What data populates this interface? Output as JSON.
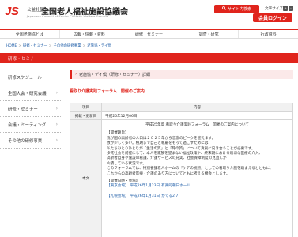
{
  "header": {
    "logo": "JS",
    "org_small": "公益社団法人",
    "org_name": "全国老人福祉施設協議会",
    "org_en": "Japanese Council of Senior Citizens Welfare Service",
    "search_label": "サイト内検索",
    "search_icon": "search-icon",
    "font_size_label": "文字サイズ",
    "font_plus": "+",
    "font_minus": "-",
    "login_label": "会員ログイン"
  },
  "nav": {
    "items": [
      "全国老施協とは",
      "広報・情報・資料",
      "研修・セミナー",
      "調査・研究",
      "行政資料"
    ]
  },
  "breadcrumb": {
    "items": [
      "HOME",
      "研修・セミナー",
      "その他の研修事業",
      "老施協・デイ倶"
    ],
    "sep": ">"
  },
  "banner": {
    "title": "研修・セミナー"
  },
  "sidebar": {
    "items": [
      "研修スケジュール",
      "全国大会・研究会議",
      "研修・セミナー",
      "会議・ミーティング",
      "その他の研修事業"
    ],
    "chev": "›"
  },
  "main": {
    "title_icon": "›",
    "title": "老施協・デイ倶（研修・セミナー）詳細",
    "sub_title": "看取り介護実践フォーラム　開催のご案内",
    "table": {
      "col_item": "項目",
      "col_content": "内容",
      "date_label": "掲載・更新日",
      "date_value": "平成25年12月06日",
      "body_label": "本文",
      "body_heading": "平成25年度 看取り介護実践フォーラム　開催のご案内について",
      "purpose_head": "【開催趣旨】",
      "purpose_text": "我が国の高齢者の人口は２０２５年から急激のピークを迎えます。\n数が少しく多い。極期まで自己と尊厳をもって過ごすためには\n私たちひとりひとりが「生活の質」と「死の質」について真剣に向き合うことが必要です。\n多死社会を前提にして、本人を家族を望まない福祉政策や、終末期における適切な医療の介入、\n高齢者自身や施設の看護、介護サービスの充実、社会保障制度の見直しが\n山積している状況です。\nこのフォーラムでは、特別養護老人ホームの『ケアの視点』としての看取り介護を踏まえるとともに、\nこれからの高齢者医療・介護のあり方についてともに考える機会とします。",
      "venue_head": "【開催日時・会場】",
      "venue1_label": "【東京会場】",
      "venue1_date": "平成26年1月23日",
      "venue1_place": "有楽町朝日ホール",
      "venue2_label": "【札幌会場】",
      "venue2_date": "平成26年1月31日",
      "venue2_place": "かでる2.7"
    }
  },
  "colors": {
    "brand_red": "#e0241c",
    "link_blue": "#1a5aa6"
  }
}
